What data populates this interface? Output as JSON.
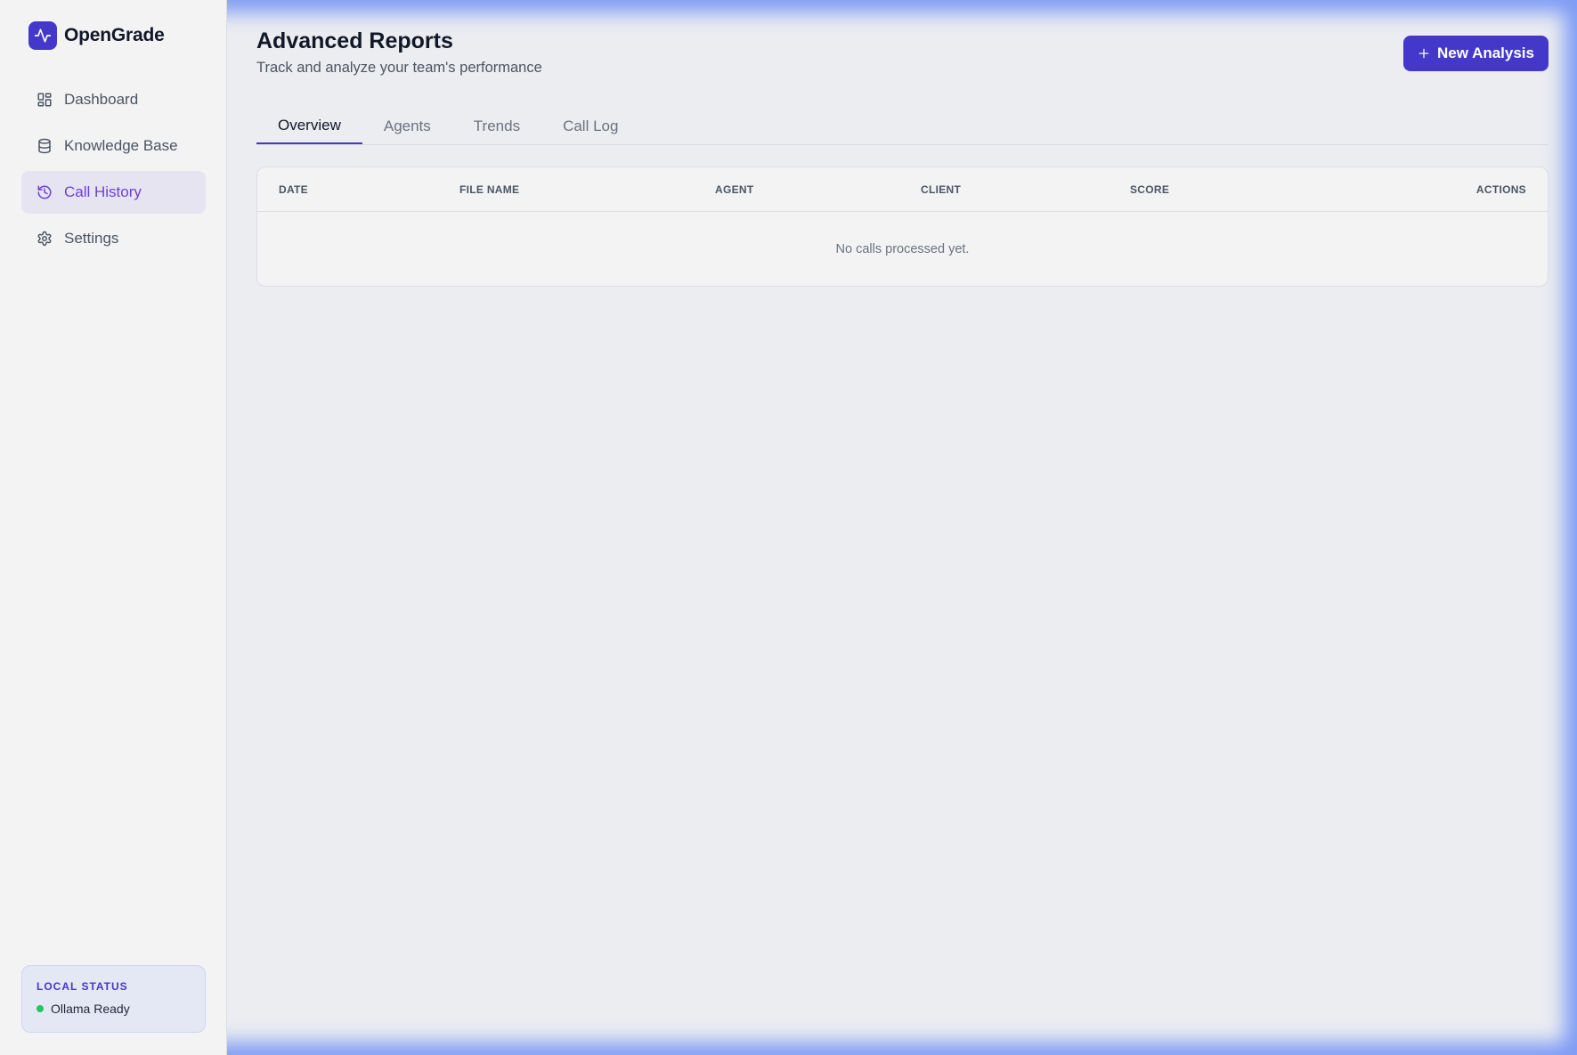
{
  "app": {
    "name": "OpenGrade",
    "logo_icon": "activity-pulse-icon",
    "accent_color": "#4338ca"
  },
  "sidebar": {
    "items": [
      {
        "label": "Dashboard",
        "icon": "layout-grid-icon",
        "active": false
      },
      {
        "label": "Knowledge Base",
        "icon": "database-icon",
        "active": false
      },
      {
        "label": "Call History",
        "icon": "history-icon",
        "active": true
      },
      {
        "label": "Settings",
        "icon": "gear-icon",
        "active": false
      }
    ],
    "status": {
      "title": "LOCAL STATUS",
      "text": "Ollama Ready",
      "dot_color": "#22c55e"
    }
  },
  "header": {
    "title": "Advanced Reports",
    "subtitle": "Track and analyze your team's performance",
    "primary_button": {
      "label": "New Analysis",
      "icon": "plus-icon"
    }
  },
  "tabs": [
    {
      "label": "Overview",
      "active": true
    },
    {
      "label": "Agents",
      "active": false
    },
    {
      "label": "Trends",
      "active": false
    },
    {
      "label": "Call Log",
      "active": false
    }
  ],
  "table": {
    "columns": [
      "DATE",
      "FILE NAME",
      "AGENT",
      "CLIENT",
      "SCORE",
      "ACTIONS"
    ],
    "empty_message": "No calls processed yet."
  }
}
